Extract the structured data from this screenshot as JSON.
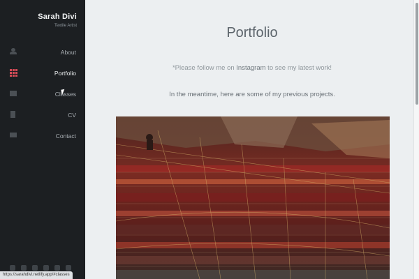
{
  "sidebar": {
    "name": "Sarah Divi",
    "subtitle": "Textile Artist",
    "items": [
      {
        "label": "About",
        "icon": "user-icon"
      },
      {
        "label": "Portfolio",
        "icon": "grid-icon",
        "active": true
      },
      {
        "label": "Classes",
        "icon": "book-icon"
      },
      {
        "label": "CV",
        "icon": "document-icon"
      },
      {
        "label": "Contact",
        "icon": "mail-icon"
      }
    ],
    "socials": [
      "twitter-icon",
      "facebook-icon",
      "tiktok-icon",
      "instagram-icon",
      "youtube-icon",
      "email-icon"
    ],
    "accent_color": "#d44b57"
  },
  "status_bar": {
    "url": "https://sarahdivi.netlify.app/#classes"
  },
  "main": {
    "title": "Portfolio",
    "message_prefix": "*Please follow me on ",
    "message_link": "Instagram",
    "message_suffix": " to see my latest work!",
    "message2": "In the meantime, here are some of my previous projects."
  }
}
